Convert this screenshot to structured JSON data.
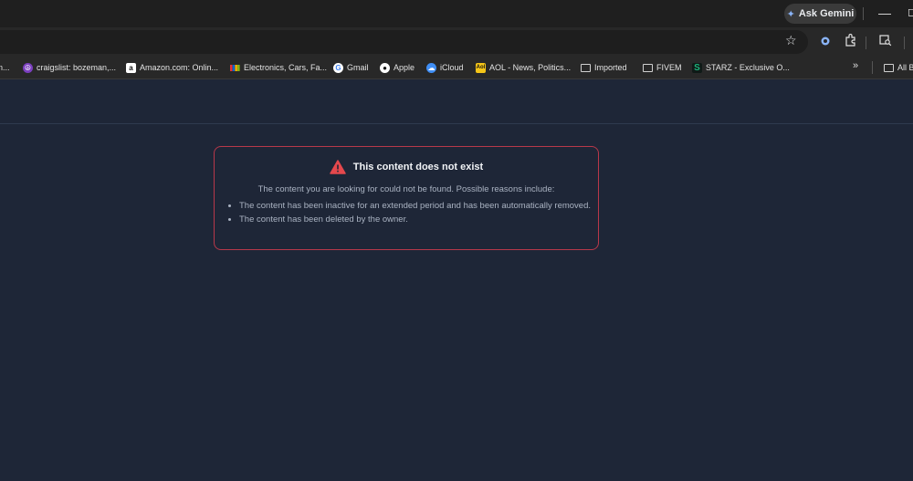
{
  "browser": {
    "gemini_label": "Ask Gemini",
    "minimize_glyph": "—",
    "maximize_glyph": "◻"
  },
  "bookmarks": {
    "items": [
      {
        "label": "n...",
        "icon": "truncated"
      },
      {
        "label": "craigslist: bozeman,...",
        "icon": "craigslist-icon",
        "color": "#7b3fbf"
      },
      {
        "label": "Amazon.com: Onlin...",
        "icon": "amazon-icon",
        "color": "#ffffff"
      },
      {
        "label": "Electronics, Cars, Fa...",
        "icon": "ebay-icon"
      },
      {
        "label": "Gmail",
        "icon": "google-icon"
      },
      {
        "label": "Apple",
        "icon": "apple-icon"
      },
      {
        "label": "iCloud",
        "icon": "icloud-icon",
        "color": "#3f8ef5"
      },
      {
        "label": "AOL - News, Politics...",
        "icon": "aol-icon",
        "color": "#f5c518"
      },
      {
        "label": "Imported",
        "icon": "folder-icon"
      },
      {
        "label": "FIVEM",
        "icon": "folder-icon"
      },
      {
        "label": "STARZ - Exclusive O...",
        "icon": "starz-icon",
        "color": "#1db37a"
      }
    ],
    "overflow_glyph": "»",
    "all_bookmarks_label": "All B"
  },
  "error": {
    "title": "This content does not exist",
    "subtitle": "The content you are looking for could not be found. Possible reasons include:",
    "reasons": [
      "The content has been inactive for an extended period and has been automatically removed.",
      "The content has been deleted by the owner."
    ],
    "accent_color": "#e5484d"
  }
}
